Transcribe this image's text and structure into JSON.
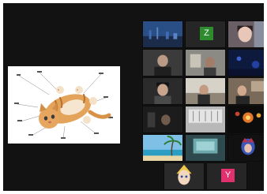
{
  "participants": [
    {
      "id": "p1",
      "label": "",
      "kind": "video",
      "scene": "city-skyline"
    },
    {
      "id": "p2",
      "label": "",
      "kind": "avatar",
      "letter": "Z",
      "color": "#2e8b2e"
    },
    {
      "id": "p3",
      "label": "",
      "kind": "video",
      "scene": "person-face"
    },
    {
      "id": "p4",
      "label": "",
      "kind": "video",
      "scene": "person-dim"
    },
    {
      "id": "p5",
      "label": "",
      "kind": "video",
      "scene": "room"
    },
    {
      "id": "p6",
      "label": "",
      "kind": "video",
      "scene": "night-blue"
    },
    {
      "id": "p7",
      "label": "",
      "kind": "video",
      "scene": "person-dark"
    },
    {
      "id": "p8",
      "label": "",
      "kind": "video",
      "scene": "person-couch"
    },
    {
      "id": "p9",
      "label": "",
      "kind": "video",
      "scene": "person-room"
    },
    {
      "id": "p10",
      "label": "",
      "kind": "video",
      "scene": "dark-room"
    },
    {
      "id": "p11",
      "label": "",
      "kind": "video",
      "scene": "office-wall"
    },
    {
      "id": "p12",
      "label": "",
      "kind": "video",
      "scene": "fireworks"
    },
    {
      "id": "p13",
      "label": "",
      "kind": "video",
      "scene": "beach-palm"
    },
    {
      "id": "p14",
      "label": "",
      "kind": "video",
      "scene": "screen-teal"
    },
    {
      "id": "p15",
      "label": "",
      "kind": "video",
      "scene": "anime-character"
    },
    {
      "id": "p16",
      "label": "",
      "kind": "video",
      "scene": "anime-face"
    },
    {
      "id": "p17",
      "label": "",
      "kind": "avatar",
      "letter": "Y",
      "color": "#e0306e"
    }
  ],
  "shared_screen": {
    "content": "annotated-kitten-photo",
    "background": "#ffffff"
  },
  "colors": {
    "app_background": "#121212",
    "tile_background": "#262626"
  }
}
